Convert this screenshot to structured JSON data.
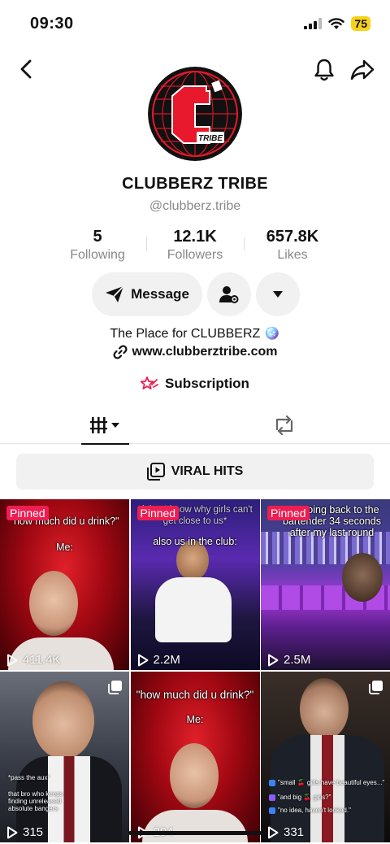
{
  "status": {
    "time": "09:30",
    "battery": "75"
  },
  "profile": {
    "name": "CLUBBERZ TRIBE",
    "handle": "@clubberz.tribe",
    "logo_text": "TRIBE"
  },
  "stats": [
    {
      "value": "5",
      "label": "Following"
    },
    {
      "value": "12.1K",
      "label": "Followers"
    },
    {
      "value": "657.8K",
      "label": "Likes"
    }
  ],
  "actions": {
    "message_label": "Message"
  },
  "bio": {
    "text": "The Place for CLUBBERZ 🪩",
    "link": "www.clubberztribe.com",
    "subscription": "Subscription"
  },
  "playlist": {
    "label": "VIRAL HITS"
  },
  "videos": [
    {
      "pinned": "Pinned",
      "caption_top": "\"how much did u drink?\"",
      "caption_mid": "Me:",
      "views": "411.4K"
    },
    {
      "pinned": "Pinned",
      "caption_top": "clubs: I know why girls can't get close to us*",
      "caption_mid": "also us in the club:",
      "views": "2.2M"
    },
    {
      "pinned": "Pinned",
      "caption_top": "me going back to the bartender 34 seconds after my last round",
      "views": "2.5M"
    },
    {
      "caption_a": "*pass the aux*",
      "caption_b": "that bro who keeps finding unreleased absolute bangers",
      "views": "315"
    },
    {
      "caption_top": "\"how much did u drink?\"",
      "caption_mid": "Me:",
      "views": "294"
    },
    {
      "chat": [
        "\"small 🍒 girls have beautiful eyes...\"",
        "\"and big 🍒 girls?\"",
        "\"no idea, haven't looked.\""
      ],
      "views": "331"
    }
  ],
  "colors": {
    "pinned": "#ee1d52",
    "accent_red": "#e8192c"
  },
  "icons": [
    "back-arrow-icon",
    "bell-icon",
    "share-icon",
    "send-icon",
    "add-friend-icon",
    "chevron-down-icon",
    "link-icon",
    "subscription-icon",
    "grid-icon",
    "repost-icon",
    "playlist-icon",
    "play-icon",
    "multi-image-icon"
  ]
}
